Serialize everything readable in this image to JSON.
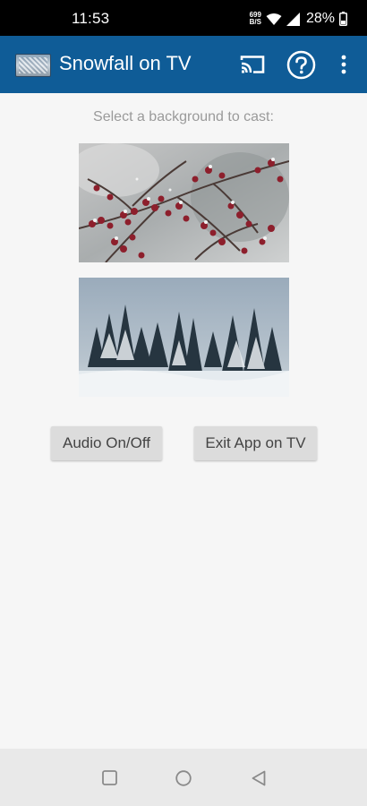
{
  "status_bar": {
    "time": "11:53",
    "data_rate_value": "699",
    "data_rate_unit": "B/S",
    "battery_percent": "28%"
  },
  "app_bar": {
    "title": "Snowfall on TV",
    "background_color": "#0f5c97",
    "icons": [
      "app-logo-icon",
      "cast-icon",
      "help-icon",
      "more-vert-icon"
    ]
  },
  "main": {
    "instruction": "Select a background to cast:",
    "backgrounds": [
      {
        "subject": "snowy red berries branch"
      },
      {
        "subject": "snowy pine forest"
      }
    ],
    "buttons": {
      "audio_label": "Audio On/Off",
      "exit_label": "Exit App on TV"
    }
  },
  "nav_bar": {
    "icons": [
      "recents-icon",
      "home-icon",
      "back-icon"
    ]
  }
}
